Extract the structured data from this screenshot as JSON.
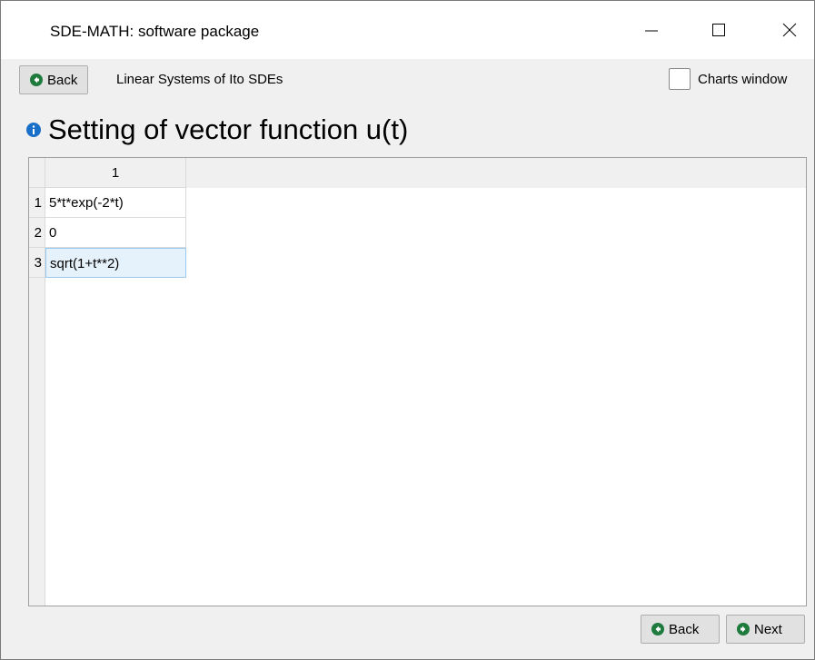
{
  "window": {
    "title": "SDE-MATH: software package"
  },
  "toolbar": {
    "back_label": "Back",
    "breadcrumb": "Linear Systems of Ito SDEs",
    "charts_label": "Charts window",
    "charts_checked": false
  },
  "heading": {
    "text": "Setting of vector function u(t)",
    "icon": "info-icon"
  },
  "table": {
    "column_headers": [
      "1"
    ],
    "rows": [
      {
        "num": "1",
        "value": "5*t*exp(-2*t)"
      },
      {
        "num": "2",
        "value": "0"
      },
      {
        "num": "3",
        "value": "sqrt(1+t**2)"
      }
    ],
    "selected_row": 3
  },
  "footer": {
    "back_label": "Back",
    "next_label": "Next"
  },
  "colors": {
    "accent_icon": "#1a6fc9",
    "go_icon": "#1f7a3d"
  }
}
